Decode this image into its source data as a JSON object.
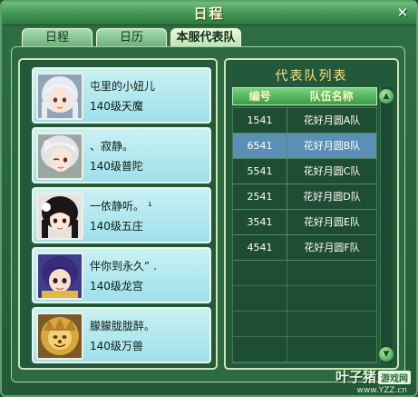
{
  "window": {
    "title": "日程",
    "close_icon": "✕"
  },
  "tabs": [
    {
      "label": "日程",
      "active": false
    },
    {
      "label": "日历",
      "active": false
    },
    {
      "label": "本服代表队",
      "active": true
    }
  ],
  "members": [
    {
      "name": "屯里的小妞儿",
      "level": "140级天魔",
      "avatar": "white-hair-girl-avatar"
    },
    {
      "name": "、寂静。",
      "level": "140级普陀",
      "avatar": "white-hair-wink-girl-avatar"
    },
    {
      "name": "一依静听。 ¹",
      "level": "140级五庄",
      "avatar": "black-hair-girl-avatar"
    },
    {
      "name": "伴你到永久” .",
      "level": "140级龙宫",
      "avatar": "purple-hair-boy-avatar"
    },
    {
      "name": "朦朦胧胧醉。",
      "level": "140级万兽",
      "avatar": "golden-lion-avatar"
    }
  ],
  "team_list": {
    "title": "代表队列表",
    "headers": {
      "id": "编号",
      "name": "队伍名称"
    },
    "rows": [
      {
        "id": "1541",
        "name": "花好月圆A队",
        "selected": false
      },
      {
        "id": "6541",
        "name": "花好月圆B队",
        "selected": true
      },
      {
        "id": "5541",
        "name": "花好月圆C队",
        "selected": false
      },
      {
        "id": "2541",
        "name": "花好月圆D队",
        "selected": false
      },
      {
        "id": "3541",
        "name": "花好月圆E队",
        "selected": false
      },
      {
        "id": "4541",
        "name": "花好月圆F队",
        "selected": false
      }
    ]
  },
  "watermark": {
    "text": "叶子猪",
    "tag": "游戏网",
    "url": "www.YZZ.cn"
  },
  "colors": {
    "accent": "#f7e77c",
    "selected_row": "#5b8fb3",
    "card": "#9fe0ea"
  }
}
